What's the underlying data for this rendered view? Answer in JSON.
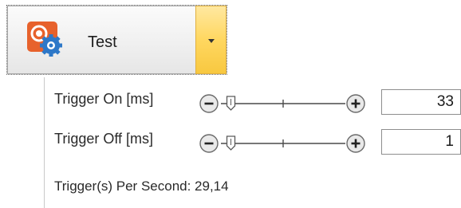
{
  "button": {
    "label": "Test",
    "icon": "gear-wrench-app-icon",
    "dropdown_icon": "chevron-down-icon"
  },
  "panel": {
    "trigger_on": {
      "label": "Trigger On [ms]",
      "value": "33",
      "slider_level": 0.08
    },
    "trigger_off": {
      "label": "Trigger Off [ms]",
      "value": "1",
      "slider_level": 0.08
    },
    "status": "Trigger(s) Per Second: 29,14"
  },
  "colors": {
    "accent_orange": "#e7622c",
    "gear_blue": "#2d78c8",
    "dropdown_yellow": "#ffd760"
  }
}
